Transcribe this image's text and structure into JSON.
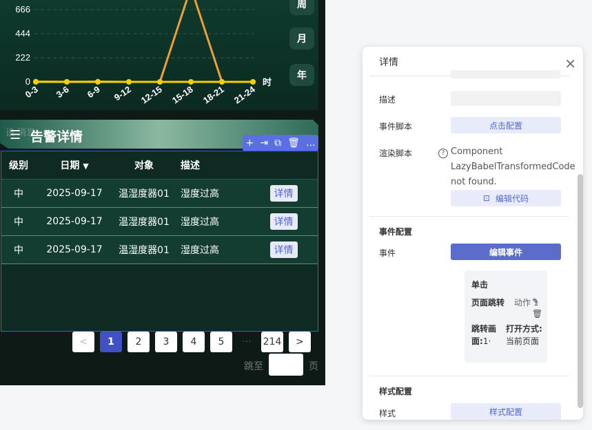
{
  "chart": {
    "y_ticks": [
      "666",
      "444",
      "222",
      "0"
    ],
    "x_ticks": [
      "0-3",
      "3-6",
      "6-9",
      "9-12",
      "12-15",
      "15-18",
      "18-21",
      "21-24"
    ],
    "x_unit": "时",
    "series_orange": [
      2,
      1,
      2,
      0,
      0,
      870,
      0,
      0
    ],
    "series_yellow": [
      0,
      0,
      0,
      0,
      0,
      0,
      0,
      0
    ],
    "colors": {
      "orange": "#f0a030",
      "yellow": "#f5d000"
    }
  },
  "range_buttons": [
    "周",
    "月",
    "年"
  ],
  "alarm": {
    "title": "告警详情",
    "ghost_text": "设 消息",
    "toolbar_icons": [
      "+",
      "⇥",
      "⧉",
      "🗑",
      "..."
    ],
    "columns": [
      "级别",
      "日期",
      "对象",
      "描述"
    ],
    "sort_icon": "▼",
    "rows": [
      {
        "level": "中",
        "date": "2025-09-17",
        "target": "温湿度器01",
        "desc": "湿度过高",
        "action": "详情"
      },
      {
        "level": "中",
        "date": "2025-09-17",
        "target": "温湿度器01",
        "desc": "湿度过高",
        "action": "详情"
      },
      {
        "level": "中",
        "date": "2025-09-17",
        "target": "温湿度器01",
        "desc": "湿度过高",
        "action": "详情"
      }
    ]
  },
  "pager": {
    "prev": "<",
    "pages": [
      "1",
      "2",
      "3",
      "4",
      "5"
    ],
    "dots": "···",
    "last": "214",
    "next": ">",
    "jump_label": "跳至",
    "jump_unit": "页"
  },
  "detail": {
    "title": "详情",
    "close": "×",
    "desc_label": "描述",
    "event_script_label": "事件脚本",
    "event_script_btn": "点击配置",
    "render_script_label": "渲染脚本",
    "render_msg": "Component LazyBabelTransformedCode not found.",
    "edit_code_btn": "编辑代码",
    "event_config_title": "事件配置",
    "event_label": "事件",
    "edit_event_btn": "编辑事件",
    "card": {
      "title": "单击",
      "action_label": "页面跳转",
      "action_value": "动作 1",
      "jump_label": "跳转画面:",
      "jump_value": "1·",
      "open_label": "打开方式:",
      "open_value": "当前页面"
    },
    "style_config_title": "样式配置",
    "style_label": "样式",
    "style_btn": "样式配置"
  }
}
